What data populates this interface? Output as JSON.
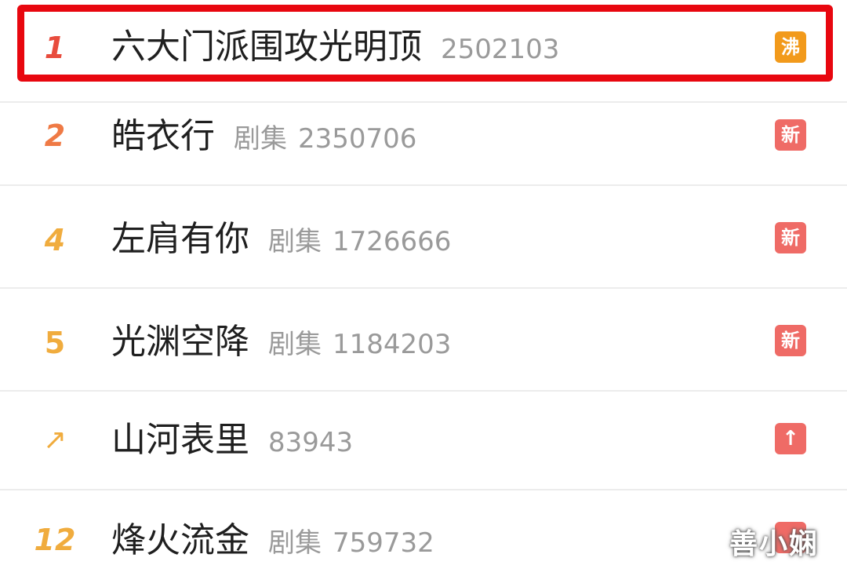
{
  "hot_list": {
    "items": [
      {
        "rank": "1",
        "title": "六大门派围攻光明顶",
        "category": "",
        "count": "2502103",
        "badge": "沸",
        "badge_color": "#f29a1b",
        "rank_color": "#e84c3d"
      },
      {
        "rank": "2",
        "title": "皓衣行",
        "category": "剧集",
        "count": "2350706",
        "badge": "新",
        "badge_color": "#ef6b66",
        "rank_color": "#ef7a45"
      },
      {
        "rank": "4",
        "title": "左肩有你",
        "category": "剧集",
        "count": "1726666",
        "badge": "新",
        "badge_color": "#ef6b66",
        "rank_color": "#f0ac3e"
      },
      {
        "rank": "5",
        "title": "光渊空降",
        "category": "剧集",
        "count": "1184203",
        "badge": "新",
        "badge_color": "#ef6b66",
        "rank_color": "#f0ac3e"
      },
      {
        "rank": "↗",
        "title": "山河表里",
        "category": "",
        "count": "83943",
        "badge": "↑",
        "badge_color": "#ef6b66",
        "rank_color": "#f0ac3e"
      },
      {
        "rank": "12",
        "title": "烽火流金",
        "category": "剧集",
        "count": "759732",
        "badge": "",
        "badge_color": "#ef6b66",
        "rank_color": "#f0ac3e"
      }
    ]
  },
  "watermark": "善小娴",
  "highlight_color": "#e8070f"
}
